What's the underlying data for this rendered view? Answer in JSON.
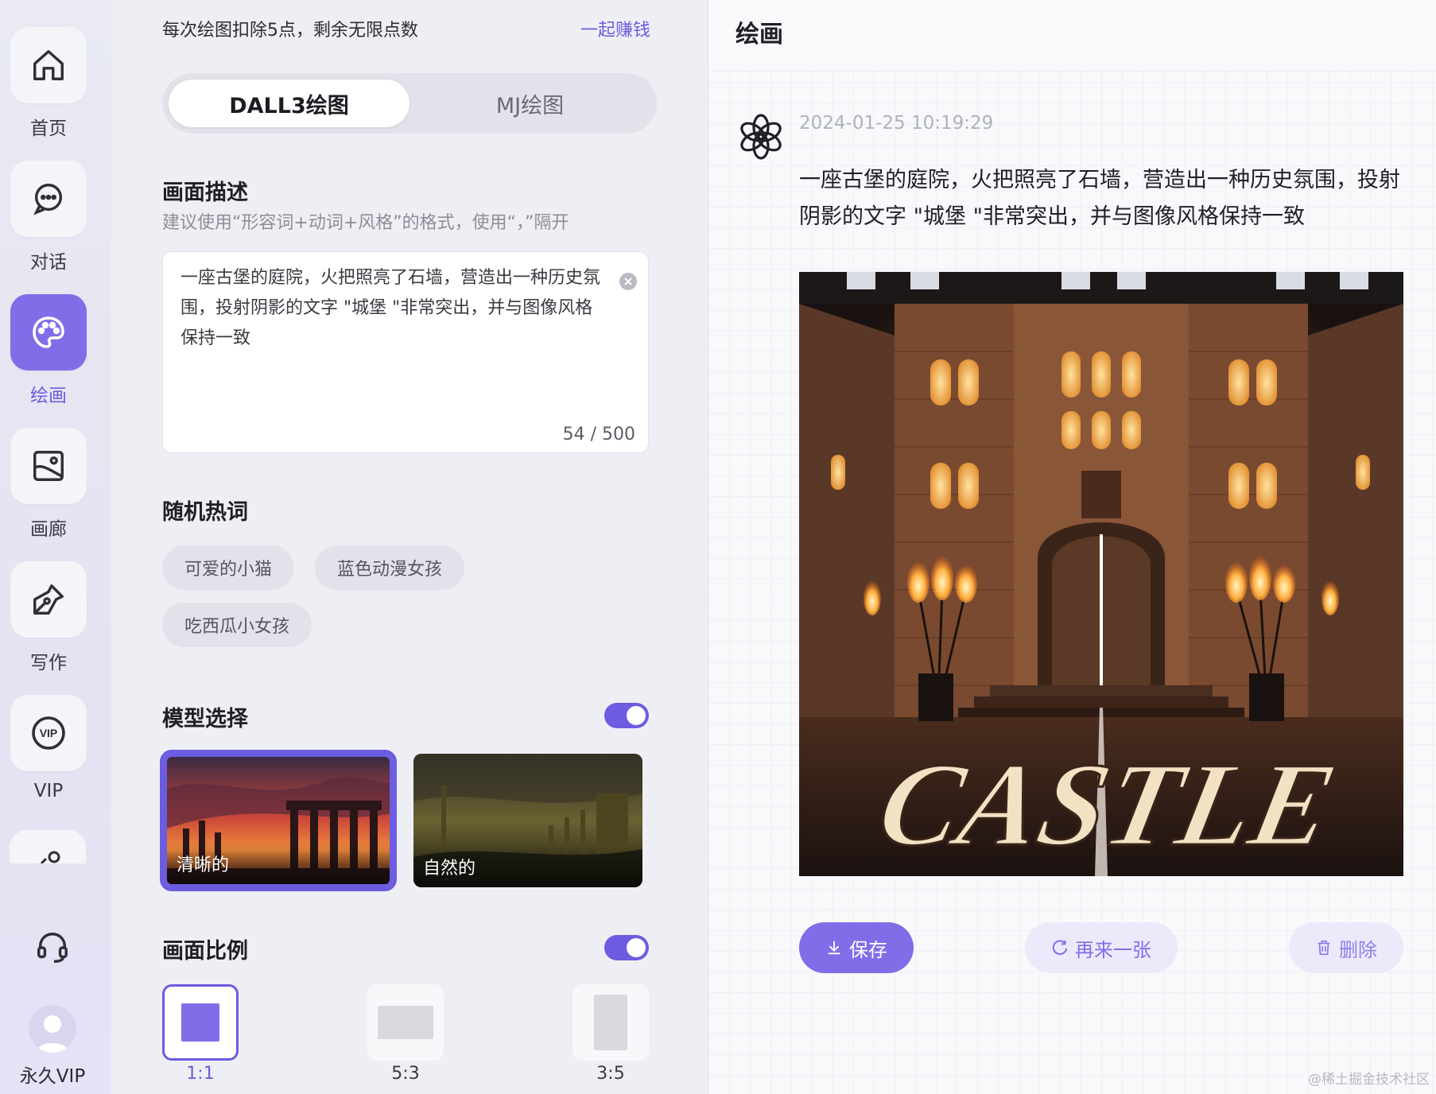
{
  "nav": {
    "items": [
      {
        "label": "首页",
        "icon": "home-icon"
      },
      {
        "label": "对话",
        "icon": "chat-icon"
      },
      {
        "label": "绘画",
        "icon": "palette-icon",
        "active": true
      },
      {
        "label": "画廊",
        "icon": "gallery-icon"
      },
      {
        "label": "写作",
        "icon": "pen-icon"
      },
      {
        "label": "VIP",
        "icon": "vip-icon"
      }
    ],
    "account_label": "永久VIP"
  },
  "panel": {
    "notice": "每次绘图扣除5点，剩余无限点数",
    "earn_link": "一起赚钱",
    "modes": [
      {
        "label": "DALL3绘图",
        "active": true
      },
      {
        "label": "MJ绘图",
        "active": false
      }
    ],
    "description": {
      "title": "画面描述",
      "hint": "建议使用“形容词+动词+风格”的格式，使用“，”隔开",
      "value": "一座古堡的庭院，火把照亮了石墙，营造出一种历史氛围，投射阴影的文字 \"城堡 \"非常突出，并与图像风格保持一致",
      "counter": "54 / 500"
    },
    "hot_words": {
      "title": "随机热词",
      "chips": [
        "可爱的小猫",
        "蓝色动漫女孩",
        "吃西瓜小女孩"
      ]
    },
    "model": {
      "title": "模型选择",
      "enabled": true,
      "options": [
        {
          "label": "清晰的",
          "selected": true
        },
        {
          "label": "自然的",
          "selected": false
        }
      ]
    },
    "ratio": {
      "title": "画面比例",
      "enabled": true,
      "options": [
        {
          "label": "1:1",
          "selected": true
        },
        {
          "label": "5:3",
          "selected": false
        },
        {
          "label": "3:5",
          "selected": false
        }
      ]
    }
  },
  "result": {
    "title": "绘画",
    "timestamp": "2024-01-25 10:19:29",
    "prompt": "一座古堡的庭院，火把照亮了石墙，营造出一种历史氛围，投射阴影的文字 \"城堡 \"非常突出，并与图像风格保持一致",
    "image_text": "CASTLE",
    "actions": {
      "save": "保存",
      "again": "再来一张",
      "delete": "删除"
    }
  },
  "watermark": "@稀土掘金技术社区",
  "colors": {
    "accent": "#6c5ce0",
    "accent_soft": "#ece9fb"
  }
}
